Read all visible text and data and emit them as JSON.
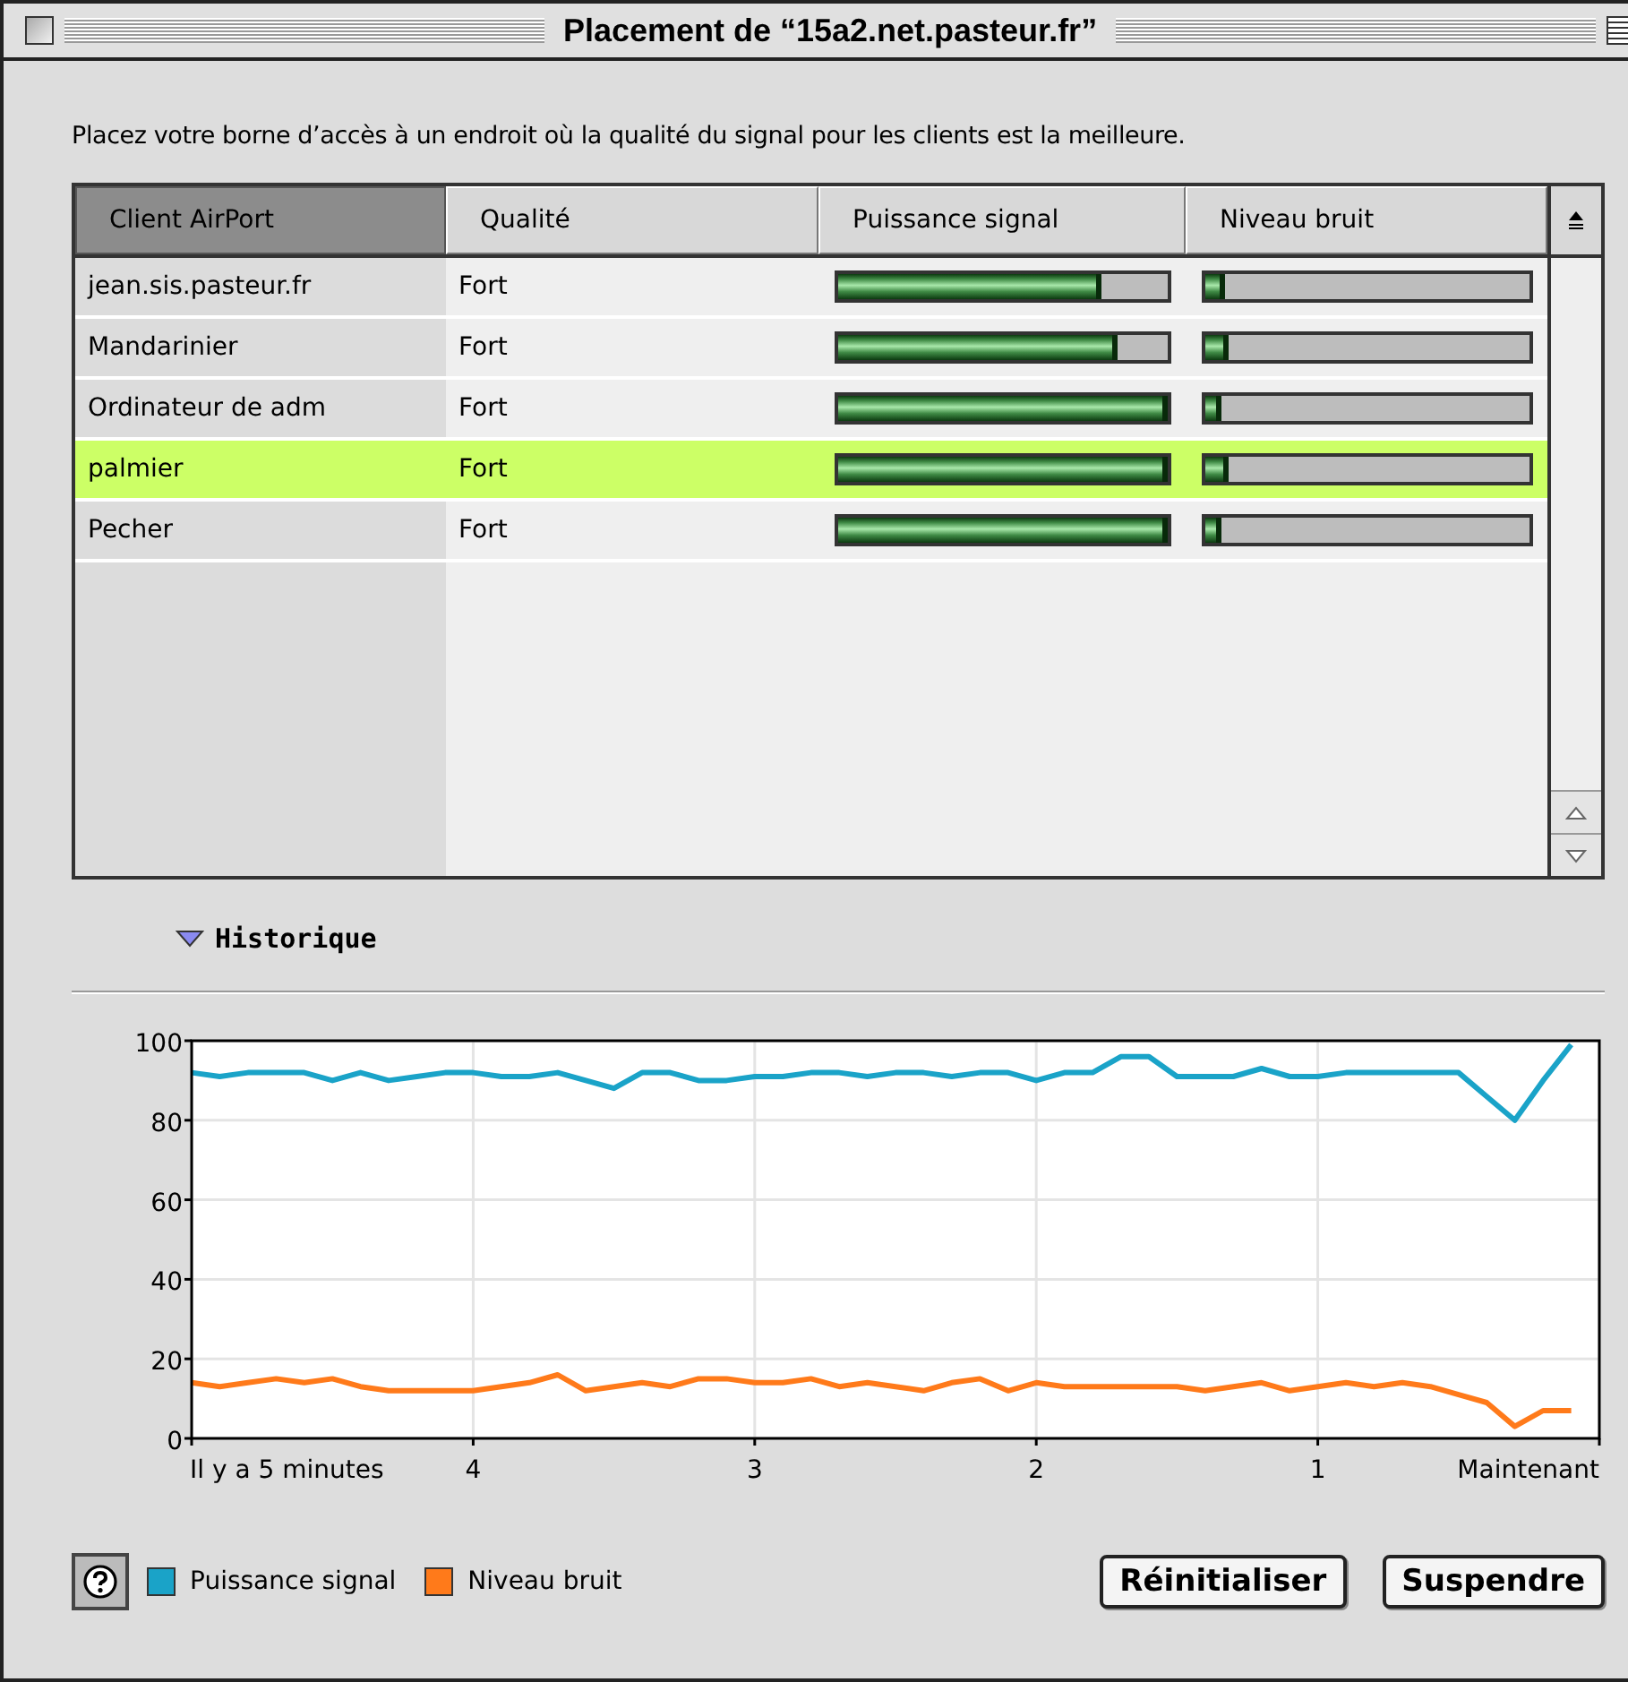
{
  "window": {
    "title": "Placement de “15a2.net.pasteur.fr”"
  },
  "instruction": "Placez votre borne d’accès à un endroit où la qualité du signal pour les clients est la meilleure.",
  "table": {
    "columns": [
      {
        "label": "Client AirPort",
        "sorted": true
      },
      {
        "label": "Qualité",
        "sorted": false
      },
      {
        "label": "Puissance signal",
        "sorted": false
      },
      {
        "label": "Niveau bruit",
        "sorted": false
      }
    ],
    "rows": [
      {
        "client": "jean.sis.pasteur.fr",
        "quality": "Fort",
        "signal": {
          "level": 0.8
        },
        "noise": {
          "level": 0.06
        },
        "selected": false
      },
      {
        "client": "Mandarinier",
        "quality": "Fort",
        "signal": {
          "level": 0.85
        },
        "noise": {
          "level": 0.07
        },
        "selected": false
      },
      {
        "client": "Ordinateur de adm",
        "quality": "Fort",
        "signal": {
          "level": 1
        },
        "noise": {
          "level": 0.05
        },
        "selected": false
      },
      {
        "client": "palmier",
        "quality": "Fort",
        "signal": {
          "level": 1
        },
        "noise": {
          "level": 0.07
        },
        "selected": true
      },
      {
        "client": "Pecher",
        "quality": "Fort",
        "signal": {
          "level": 1
        },
        "noise": {
          "level": 0.05
        },
        "selected": false
      }
    ]
  },
  "history": {
    "label": "Historique",
    "expanded": true,
    "chart_data": {
      "type": "line",
      "x": [
        5,
        4.9,
        4.8,
        4.7,
        4.6,
        4.5,
        4.4,
        4.3,
        4.2,
        4.1,
        4,
        3.9,
        3.8,
        3.7,
        3.6,
        3.5,
        3.4,
        3.3,
        3.2,
        3.1,
        3,
        2.9,
        2.8,
        2.7,
        2.6,
        2.5,
        2.4,
        2.3,
        2.2,
        2.1,
        2,
        1.9,
        1.8,
        1.7,
        1.6,
        1.5,
        1.4,
        1.3,
        1.2,
        1.1,
        1,
        0.9,
        0.8,
        0.7,
        0.6,
        0.5,
        0.4,
        0.3,
        0.2,
        0.1
      ],
      "series": [
        {
          "name": "Puissance signal",
          "color": "#1aa3c8",
          "values": [
            92,
            91,
            92,
            92,
            92,
            90,
            92,
            90,
            91,
            92,
            92,
            91,
            91,
            92,
            90,
            88,
            92,
            92,
            90,
            90,
            91,
            91,
            92,
            92,
            91,
            92,
            92,
            91,
            92,
            92,
            90,
            92,
            92,
            96,
            96,
            91,
            91,
            91,
            93,
            91,
            91,
            92,
            92,
            92,
            92,
            92,
            86,
            80,
            90,
            99
          ]
        },
        {
          "name": "Niveau bruit",
          "color": "#ff7a1a",
          "values": [
            14,
            13,
            14,
            15,
            14,
            15,
            13,
            12,
            12,
            12,
            12,
            13,
            14,
            16,
            12,
            13,
            14,
            13,
            15,
            15,
            14,
            14,
            15,
            13,
            14,
            13,
            12,
            14,
            15,
            12,
            14,
            13,
            13,
            13,
            13,
            13,
            12,
            13,
            14,
            12,
            13,
            14,
            13,
            14,
            13,
            11,
            9,
            3,
            7,
            7
          ]
        }
      ],
      "xlim": [
        5,
        0
      ],
      "ylim": [
        0,
        100
      ],
      "grid": true,
      "xticks": [
        {
          "value": 5,
          "label": "Il y a 5 minutes"
        },
        4,
        3,
        2,
        1,
        {
          "value": 0,
          "label": "Maintenant"
        }
      ],
      "yticks": [
        0,
        20,
        40,
        60,
        80,
        100
      ]
    }
  },
  "buttons": [
    {
      "label": "Réinitialiser"
    },
    {
      "label": "Suspendre"
    }
  ]
}
